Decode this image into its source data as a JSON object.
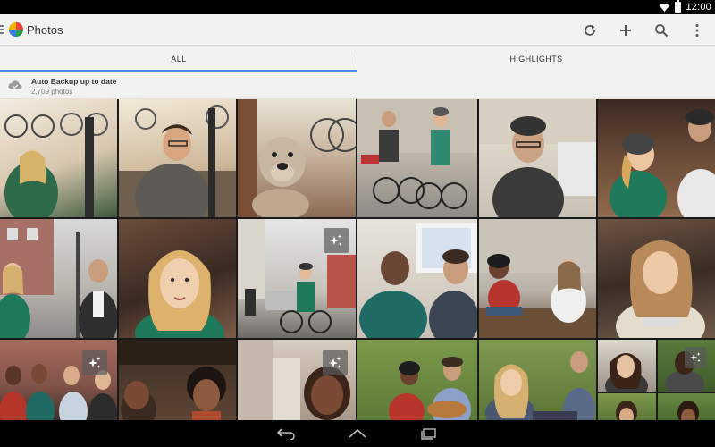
{
  "status_bar": {
    "time": "12:00"
  },
  "action_bar": {
    "title": "Photos",
    "actions": [
      "refresh-icon",
      "add-icon",
      "search-icon",
      "overflow-menu-icon"
    ]
  },
  "tabs": [
    {
      "label": "ALL",
      "active": true
    },
    {
      "label": "HIGHLIGHTS",
      "active": false
    }
  ],
  "backup": {
    "title": "Auto Backup up to date",
    "count": "2,709 photos"
  },
  "colors": {
    "accent": "#4a8af4",
    "bar_bg": "#f2f2f2"
  },
  "nav": [
    "back-icon",
    "home-icon",
    "recents-icon"
  ]
}
